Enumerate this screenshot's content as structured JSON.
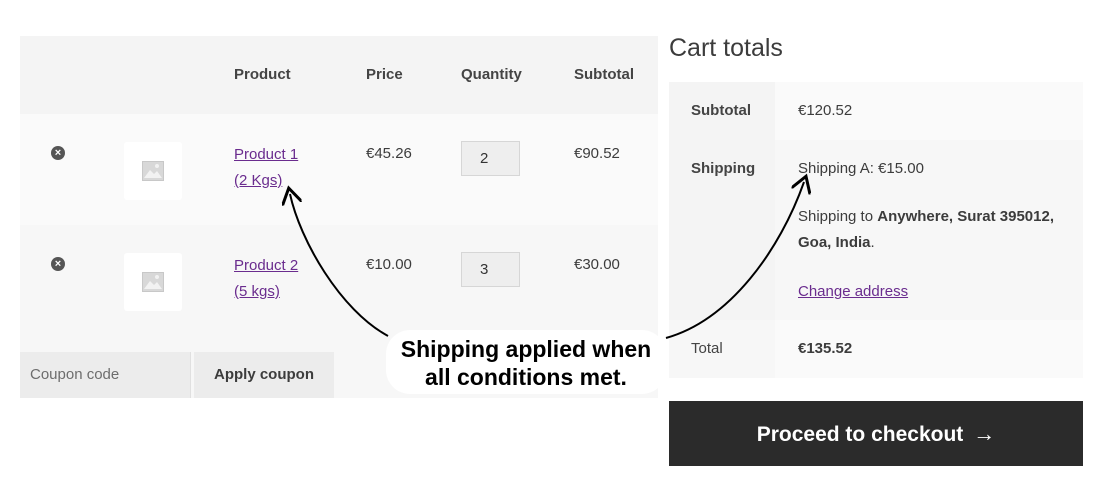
{
  "table": {
    "headers": {
      "product": "Product",
      "price": "Price",
      "quantity": "Quantity",
      "subtotal": "Subtotal"
    },
    "rows": [
      {
        "remove": "×",
        "name_line1": "Product 1",
        "name_line2": "(2 Kgs)",
        "price": "€45.26",
        "quantity": "2",
        "subtotal": "€90.52"
      },
      {
        "remove": "×",
        "name_line1": "Product 2",
        "name_line2": "(5 kgs)",
        "price": "€10.00",
        "quantity": "3",
        "subtotal": "€30.00"
      }
    ]
  },
  "coupon": {
    "placeholder": "Coupon code",
    "apply_label": "Apply coupon"
  },
  "totals": {
    "title": "Cart totals",
    "subtotal_label": "Subtotal",
    "subtotal_value": "€120.52",
    "shipping_label": "Shipping",
    "shipping_method": "Shipping A: €15.00",
    "shipping_to_prefix": "Shipping to ",
    "shipping_to_address": "Anywhere, Surat 395012, Goa, India",
    "shipping_to_suffix": ".",
    "change_address": "Change address",
    "total_label": "Total",
    "total_value": "€135.52"
  },
  "checkout": {
    "label": "Proceed to checkout",
    "icon": "→"
  },
  "annotation": {
    "line1": "Shipping applied when",
    "line2": "all conditions met."
  },
  "colors": {
    "link": "#6a2c8e",
    "checkout_bg": "#2b2b2b"
  }
}
